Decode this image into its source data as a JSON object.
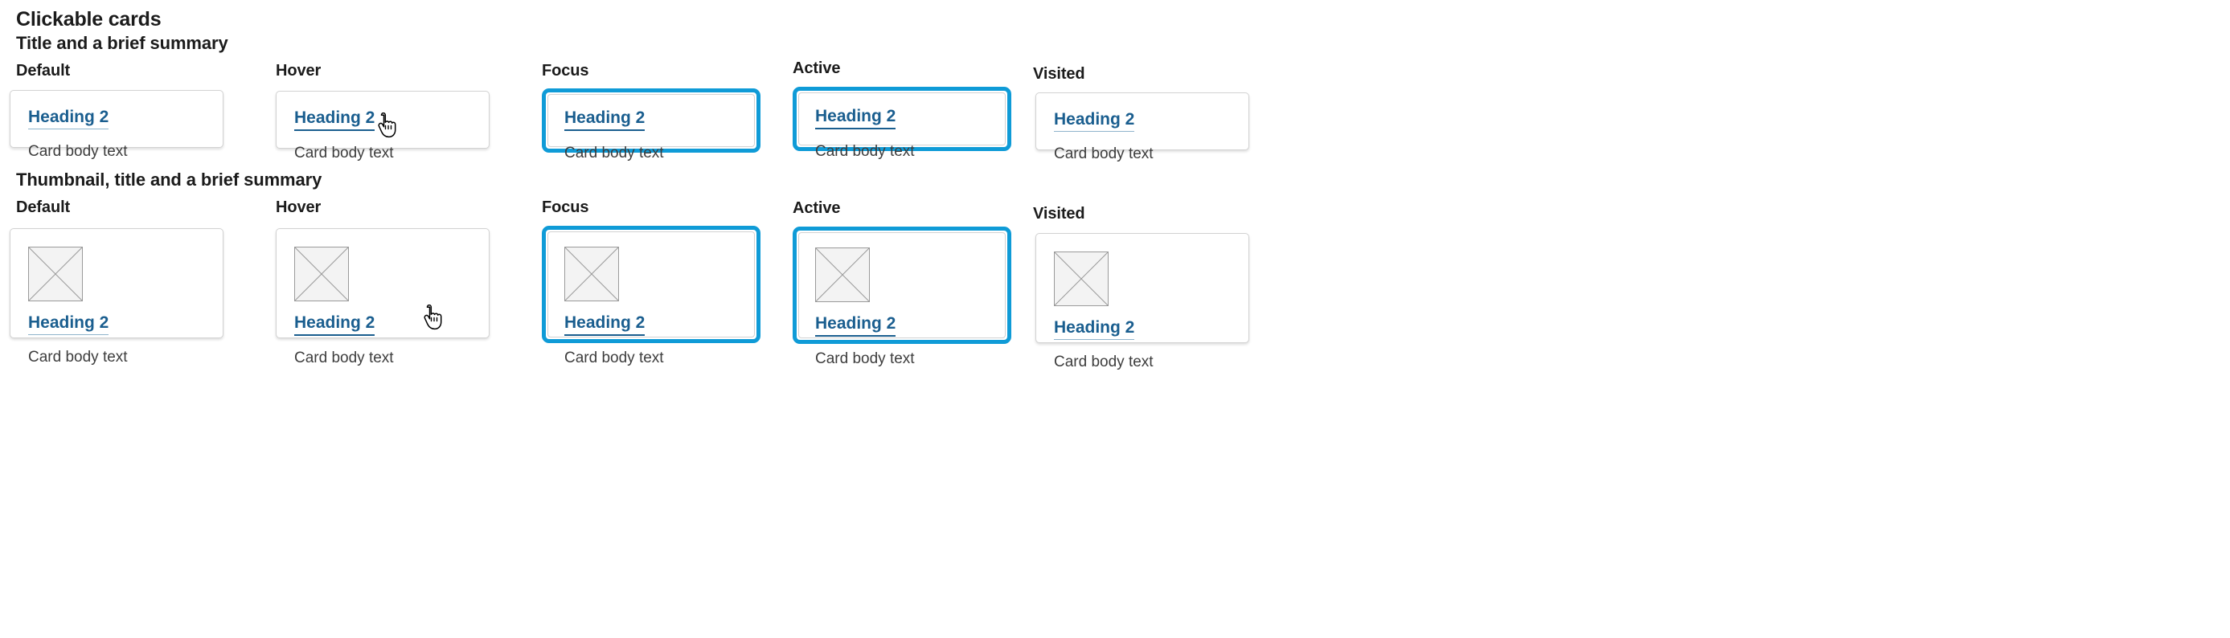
{
  "page": {
    "title": "Clickable cards"
  },
  "sections": [
    {
      "title": "Title and a brief summary",
      "cards": [
        {
          "state_label": "Default",
          "state": "default",
          "heading": "Heading 2",
          "body": "Card body text",
          "has_thumbnail": false,
          "cursor": "none"
        },
        {
          "state_label": "Hover",
          "state": "hover",
          "heading": "Heading 2",
          "body": "Card body text",
          "has_thumbnail": false,
          "cursor": "pointer-hand-cursor"
        },
        {
          "state_label": "Focus",
          "state": "focus",
          "heading": "Heading 2",
          "body": "Card body text",
          "has_thumbnail": false,
          "cursor": "none"
        },
        {
          "state_label": "Active",
          "state": "active",
          "heading": "Heading 2",
          "body": "Card body text",
          "has_thumbnail": false,
          "cursor": "none"
        },
        {
          "state_label": "Visited",
          "state": "visited",
          "heading": "Heading 2",
          "body": "Card body text",
          "has_thumbnail": false,
          "cursor": "none"
        }
      ]
    },
    {
      "title": "Thumbnail, title and a brief summary",
      "cards": [
        {
          "state_label": "Default",
          "state": "default",
          "heading": "Heading 2",
          "body": "Card body text",
          "has_thumbnail": true,
          "thumbnail_icon": "image-placeholder-icon",
          "cursor": "none"
        },
        {
          "state_label": "Hover",
          "state": "hover",
          "heading": "Heading 2",
          "body": "Card body text",
          "has_thumbnail": true,
          "thumbnail_icon": "image-placeholder-icon",
          "cursor": "pointer-hand-cursor"
        },
        {
          "state_label": "Focus",
          "state": "focus",
          "heading": "Heading 2",
          "body": "Card body text",
          "has_thumbnail": true,
          "thumbnail_icon": "image-placeholder-icon",
          "cursor": "none"
        },
        {
          "state_label": "Active",
          "state": "active",
          "heading": "Heading 2",
          "body": "Card body text",
          "has_thumbnail": true,
          "thumbnail_icon": "image-placeholder-icon",
          "cursor": "none"
        },
        {
          "state_label": "Visited",
          "state": "visited",
          "heading": "Heading 2",
          "body": "Card body text",
          "has_thumbnail": true,
          "thumbnail_icon": "image-placeholder-icon",
          "cursor": "none"
        }
      ]
    }
  ],
  "colors": {
    "link_blue": "#1a5e8f",
    "focus_ring_blue": "#0f9bd7",
    "card_border": "#d2d2d2",
    "thumbnail_fill": "#f3f3f3",
    "thumbnail_border": "#9a9a9a",
    "body_text": "#3d3d3d",
    "heading_text": "#1b1b1b",
    "background": "#ffffff"
  }
}
